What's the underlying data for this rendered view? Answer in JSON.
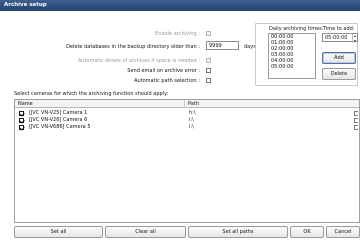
{
  "window": {
    "title": "Archive setup"
  },
  "settings": {
    "enable_archiving_label": "Enable archiving :",
    "delete_older_label": "Delete databases in the backup directory older than :",
    "days_value": "9999",
    "days_unit": "days",
    "auto_delete_label": "Automatic delete of archives if space is needed :",
    "send_email_label": "Send email on archive error :",
    "auto_path_label": "Automatic path selection :"
  },
  "daily_times": {
    "label": "Daily archiving times:",
    "times": [
      "00:00:00",
      "01:00:00",
      "02:00:00",
      "03:00:00",
      "04:00:00",
      "05:00:00"
    ]
  },
  "time_to_add": {
    "label": "Time to add:",
    "value": "05:00:00",
    "add_label": "Add",
    "delete_label": "Delete"
  },
  "cameras": {
    "section_label": "Select cameras for which the archiving function should apply:",
    "columns": [
      "Name",
      "Path"
    ],
    "rows": [
      {
        "name": "[JVC VN-V25] Camera 1",
        "path": "h:\\",
        "checked": true
      },
      {
        "name": "[JVC VN-V26] Camera 6",
        "path": "i:\\",
        "checked": true
      },
      {
        "name": "[JVC VN-V686] Camera 5",
        "path": "i:\\",
        "checked": true
      }
    ]
  },
  "footer": {
    "set_all": "Set all",
    "clear_all": "Clear all",
    "set_all_paths": "Set all paths",
    "ok": "OK",
    "cancel": "Cancel"
  },
  "colors": {
    "title_bar": "#2f4f7f",
    "disabled_text": "#9a9a9a"
  }
}
